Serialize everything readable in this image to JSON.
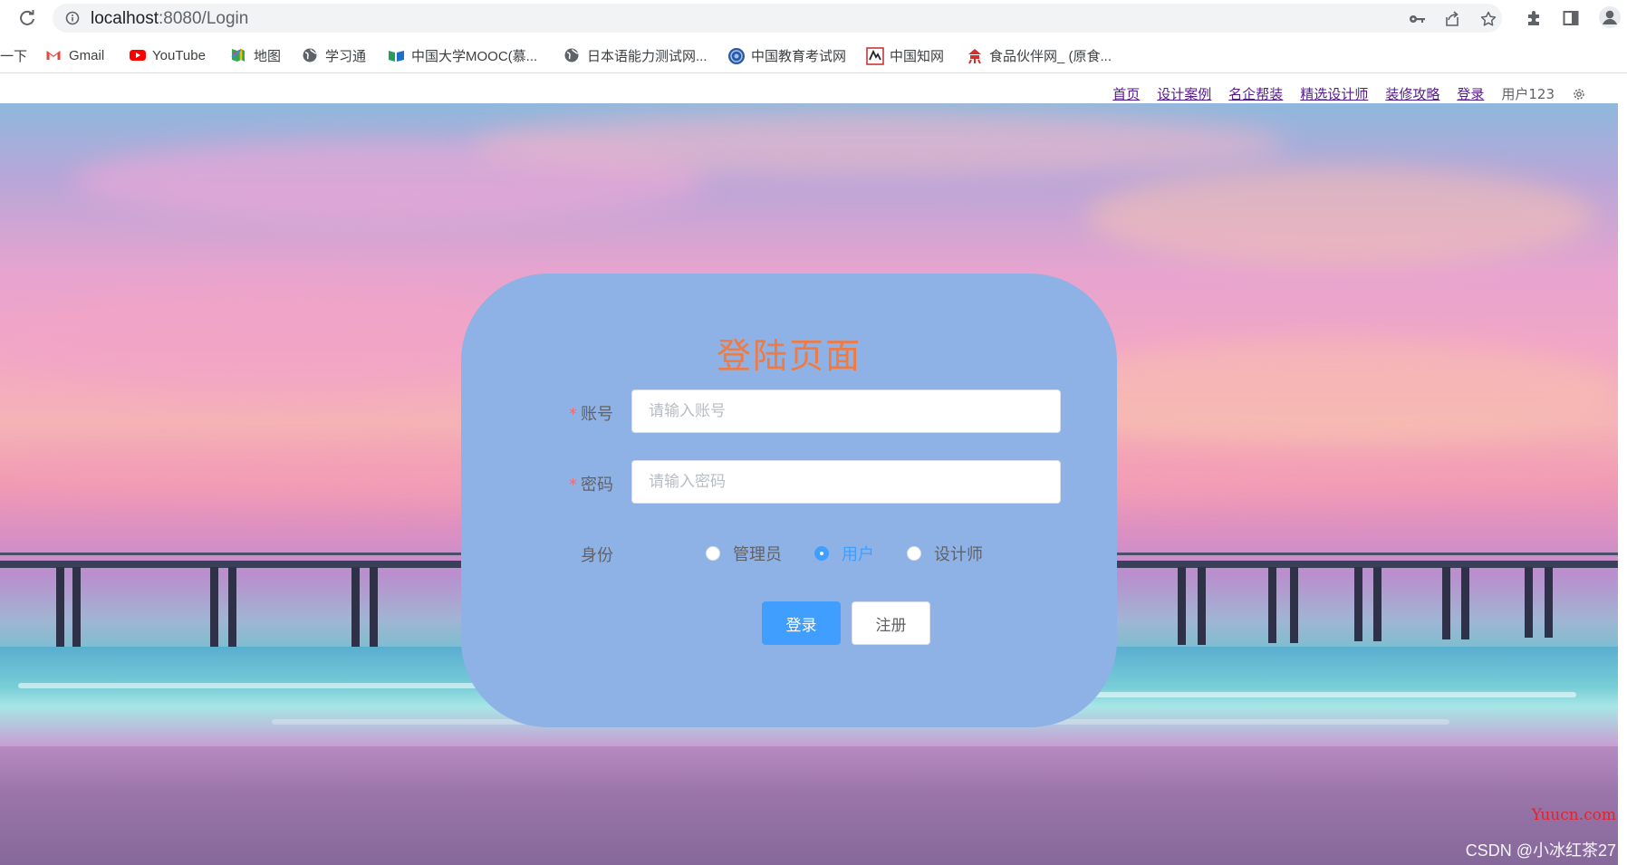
{
  "browser": {
    "url_host": "localhost",
    "url_path": ":8080/Login",
    "bookmarks": [
      {
        "label": "一下",
        "icon": "bookmark-edge-icon",
        "color": "#3c4043"
      },
      {
        "label": "Gmail",
        "icon": "gmail-icon",
        "color": "#ea4335"
      },
      {
        "label": "YouTube",
        "icon": "youtube-icon",
        "color": "#ff0000"
      },
      {
        "label": "地图",
        "icon": "maps-icon",
        "color": "#34a853"
      },
      {
        "label": "学习通",
        "icon": "globe-icon",
        "color": "#5f6368"
      },
      {
        "label": "中国大学MOOC(慕...",
        "icon": "mooc-icon",
        "color": "#22a05a"
      },
      {
        "label": "日本语能力测试网...",
        "icon": "globe-icon",
        "color": "#5f6368"
      },
      {
        "label": "中国教育考试网",
        "icon": "neea-icon",
        "color": "#2c5aa0"
      },
      {
        "label": "中国知网",
        "icon": "cnki-icon",
        "color": "#c62828"
      },
      {
        "label": "食品伙伴网_ (原食...",
        "icon": "food-icon",
        "color": "#d32f2f"
      }
    ]
  },
  "nav": {
    "links": [
      "首页",
      "设计案例",
      "名企帮装",
      "精选设计师",
      "装修攻略",
      "登录"
    ],
    "user": "用户123"
  },
  "login": {
    "title": "登陆页面",
    "account_label": "账号",
    "account_placeholder": "请输入账号",
    "password_label": "密码",
    "password_placeholder": "请输入密码",
    "role_label": "身份",
    "roles": [
      "管理员",
      "用户",
      "设计师"
    ],
    "selected_role": "用户",
    "login_button": "登录",
    "register_button": "注册"
  },
  "watermarks": {
    "yuucn": "Yuucn.com",
    "csdn": "CSDN @小冰红茶27"
  },
  "colors": {
    "card_bg": "#8fb2e6",
    "title": "#f07a3f",
    "primary": "#409eff",
    "required": "#f56c6c",
    "nav_link": "#551a8b"
  }
}
